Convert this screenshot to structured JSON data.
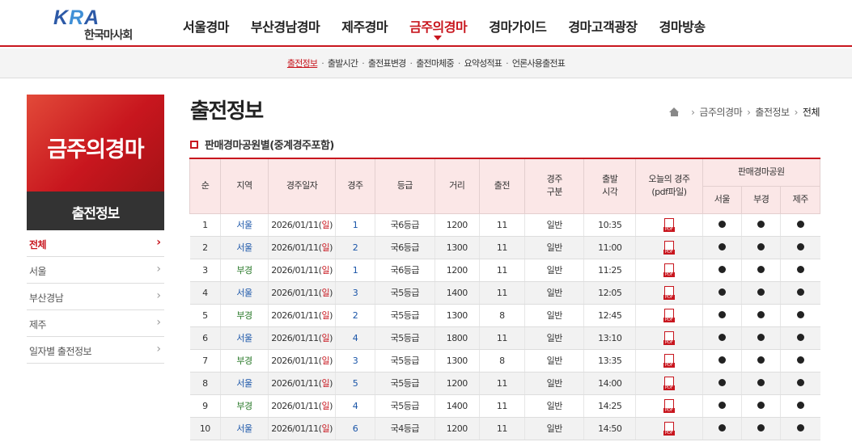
{
  "header": {
    "logo_mark_k": "K",
    "logo_mark_r": "R",
    "logo_mark_a": "A",
    "logo_text": "한국마사회",
    "nav": [
      {
        "label": "서울경마"
      },
      {
        "label": "부산경남경마"
      },
      {
        "label": "제주경마"
      },
      {
        "label": "금주의경마",
        "active": true
      },
      {
        "label": "경마가이드"
      },
      {
        "label": "경마고객광장"
      },
      {
        "label": "경마방송"
      }
    ]
  },
  "subnav": [
    {
      "label": "출전정보",
      "active": true
    },
    {
      "label": "출발시간"
    },
    {
      "label": "출전표변경"
    },
    {
      "label": "출전마체중"
    },
    {
      "label": "요약성적표"
    },
    {
      "label": "언론사용출전표"
    }
  ],
  "sidebar": {
    "banner_title": "금주의경마",
    "banner_subtitle": "출전정보",
    "items": [
      {
        "label": "전체",
        "active": true
      },
      {
        "label": "서울"
      },
      {
        "label": "부산경남"
      },
      {
        "label": "제주"
      },
      {
        "label": "일자별 출전정보"
      }
    ]
  },
  "main": {
    "title": "출전정보",
    "breadcrumb": [
      "금주의경마",
      "출전정보",
      "전체"
    ],
    "section_title": "판매경마공원별(중계경주포함)"
  },
  "table": {
    "headers": {
      "no": "순",
      "region": "지역",
      "date": "경주일자",
      "race": "경주",
      "grade": "등급",
      "distance": "거리",
      "entries": "출전",
      "race_type_1": "경주",
      "race_type_2": "구분",
      "start_1": "출발",
      "start_2": "시각",
      "pdf_1": "오늘의 경주",
      "pdf_2": "(pdf파일)",
      "parks": "판매경마공원",
      "park_seoul": "서울",
      "park_busan": "부경",
      "park_jeju": "제주"
    },
    "rows": [
      {
        "no": "1",
        "region": "서울",
        "date": "2026/01/11",
        "day": "일",
        "race": "1",
        "grade": "국6등급",
        "distance": "1200",
        "entries": "11",
        "type": "일반",
        "time": "10:35"
      },
      {
        "no": "2",
        "region": "서울",
        "date": "2026/01/11",
        "day": "일",
        "race": "2",
        "grade": "국6등급",
        "distance": "1300",
        "entries": "11",
        "type": "일반",
        "time": "11:00"
      },
      {
        "no": "3",
        "region": "부경",
        "date": "2026/01/11",
        "day": "일",
        "race": "1",
        "grade": "국6등급",
        "distance": "1200",
        "entries": "11",
        "type": "일반",
        "time": "11:25"
      },
      {
        "no": "4",
        "region": "서울",
        "date": "2026/01/11",
        "day": "일",
        "race": "3",
        "grade": "국5등급",
        "distance": "1400",
        "entries": "11",
        "type": "일반",
        "time": "12:05"
      },
      {
        "no": "5",
        "region": "부경",
        "date": "2026/01/11",
        "day": "일",
        "race": "2",
        "grade": "국5등급",
        "distance": "1300",
        "entries": "8",
        "type": "일반",
        "time": "12:45"
      },
      {
        "no": "6",
        "region": "서울",
        "date": "2026/01/11",
        "day": "일",
        "race": "4",
        "grade": "국5등급",
        "distance": "1800",
        "entries": "11",
        "type": "일반",
        "time": "13:10"
      },
      {
        "no": "7",
        "region": "부경",
        "date": "2026/01/11",
        "day": "일",
        "race": "3",
        "grade": "국5등급",
        "distance": "1300",
        "entries": "8",
        "type": "일반",
        "time": "13:35"
      },
      {
        "no": "8",
        "region": "서울",
        "date": "2026/01/11",
        "day": "일",
        "race": "5",
        "grade": "국5등급",
        "distance": "1200",
        "entries": "11",
        "type": "일반",
        "time": "14:00"
      },
      {
        "no": "9",
        "region": "부경",
        "date": "2026/01/11",
        "day": "일",
        "race": "4",
        "grade": "국5등급",
        "distance": "1400",
        "entries": "11",
        "type": "일반",
        "time": "14:25"
      },
      {
        "no": "10",
        "region": "서울",
        "date": "2026/01/11",
        "day": "일",
        "race": "6",
        "grade": "국4등급",
        "distance": "1200",
        "entries": "11",
        "type": "일반",
        "time": "14:50"
      }
    ],
    "pdf_tag": "PDF"
  },
  "colors": {
    "accent": "#c8161e",
    "seoul": "#1a55a8",
    "busan": "#2a7a2a",
    "header_bg": "#fbe7e7"
  }
}
